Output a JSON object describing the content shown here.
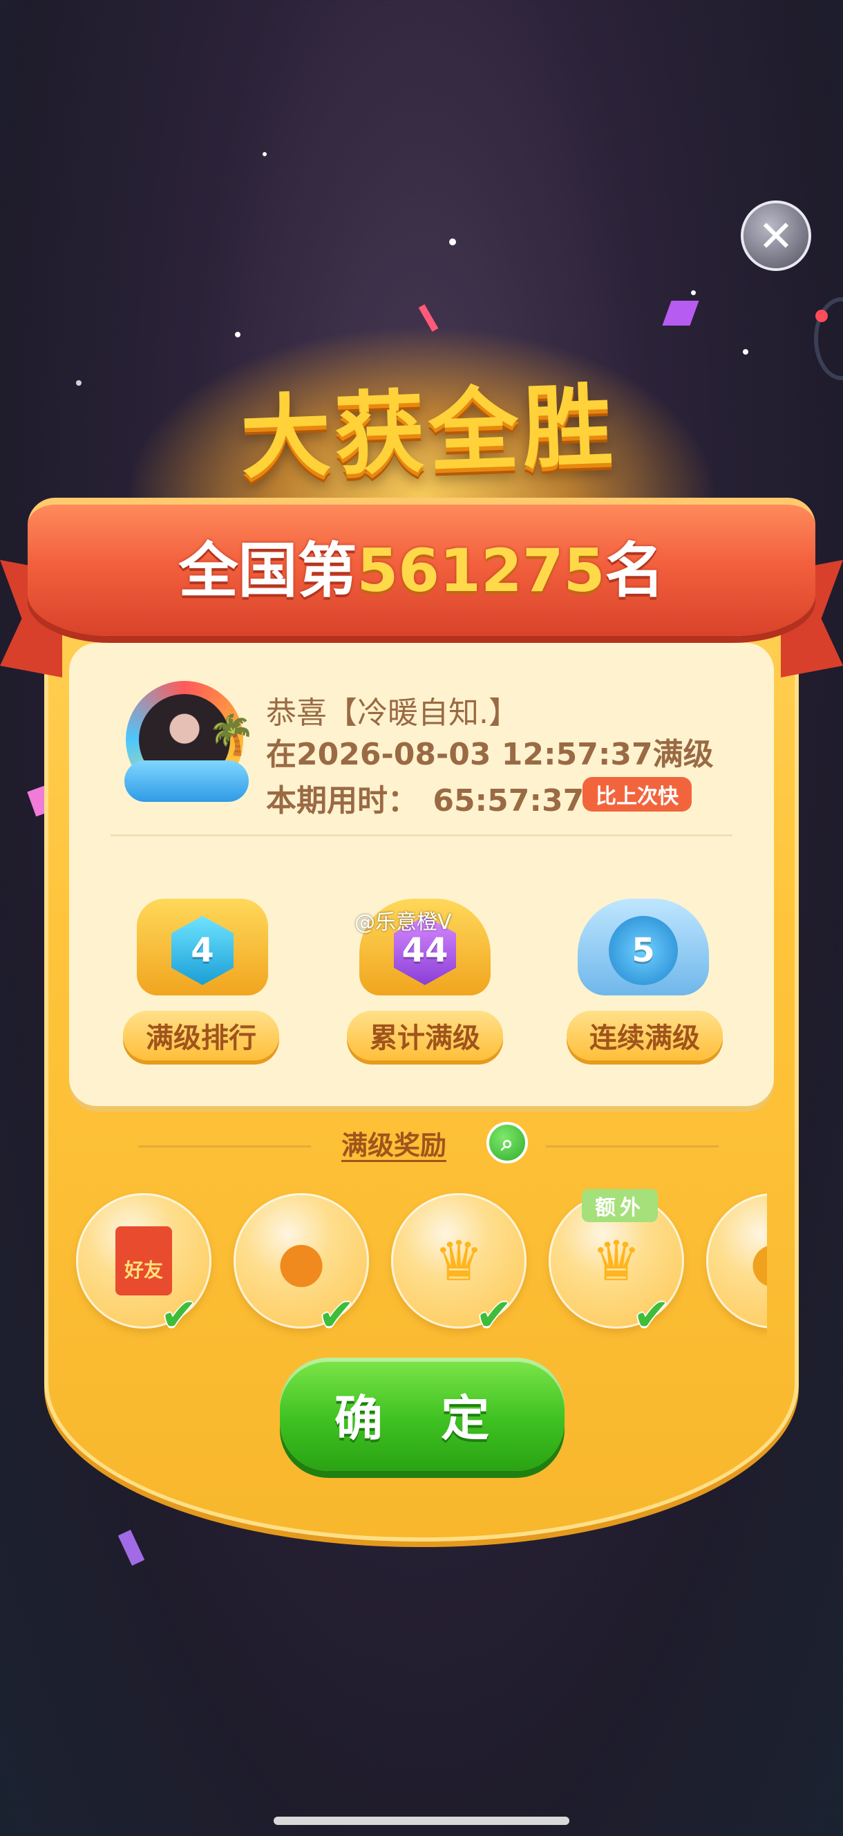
{
  "title": "大获全胜",
  "rank": {
    "prefix": "全国第",
    "number": "561275",
    "suffix": "名"
  },
  "user": {
    "congrats": "恭喜【冷暖自知.】",
    "time_line": "在2026-08-03 12:57:37满级",
    "period_label": "本期用时：",
    "period_value": "65:57:37",
    "faster_badge": "比上次快"
  },
  "medals": [
    {
      "value": "4",
      "label": "满级排行"
    },
    {
      "value": "44",
      "label": "累计满级"
    },
    {
      "value": "5",
      "label": "连续满级"
    }
  ],
  "watermark": "@乐意橙V",
  "rewards": {
    "header": "满级奖励",
    "extra_tag": "额外",
    "items": [
      {
        "icon": "red-envelope-icon",
        "text": "好友"
      },
      {
        "icon": "persimmon-icon"
      },
      {
        "icon": "crown-icon"
      },
      {
        "icon": "crown-icon"
      },
      {
        "icon": "partial-item-icon"
      }
    ]
  },
  "confirm_label": "确 定",
  "close_label": "✕",
  "colors": {
    "ribbon": "#f2603d",
    "card": "#ffc43b",
    "confirm": "#3fc122",
    "gold": "#ffd23a"
  }
}
